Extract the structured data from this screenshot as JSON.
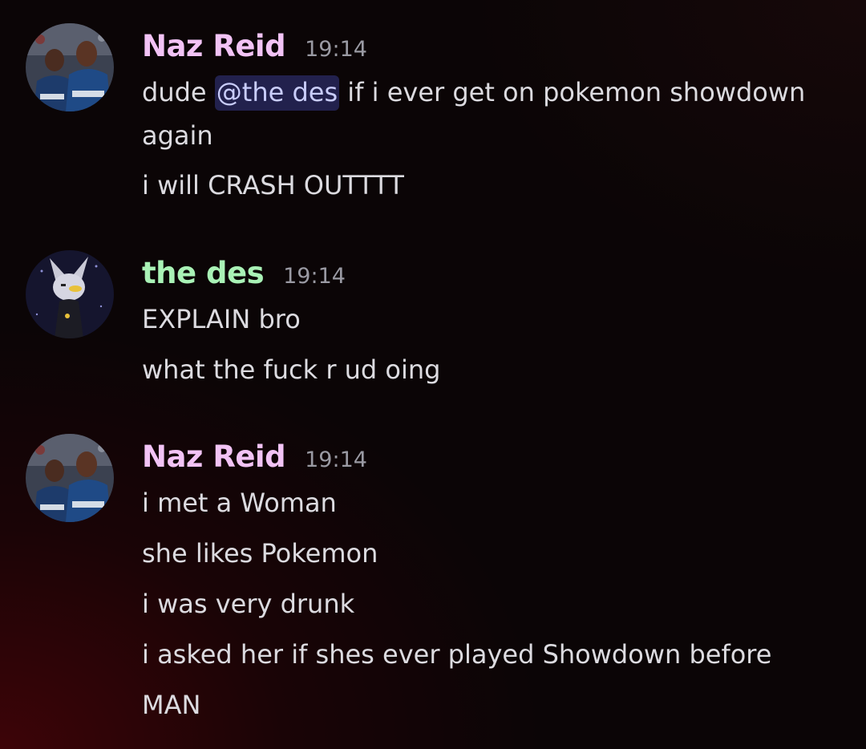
{
  "colors": {
    "naz_name": "#f2c3f5",
    "des_name": "#a9f2b6",
    "mention_bg": "#3a3f7a",
    "message_text": "#dcdbe0",
    "timestamp": "#9a9aa3"
  },
  "messages": [
    {
      "author": "Naz Reid",
      "time": "19:14",
      "avatar_icon": "basketball-players-avatar",
      "line1_before": "dude ",
      "mention": "@the des",
      "line1_after": " if i ever get on pokemon showdown",
      "line1_cont": "again",
      "line2": "i will CRASH OUTTTT"
    },
    {
      "author": "the des",
      "time": "19:14",
      "avatar_icon": "cartoon-character-avatar",
      "line1": "EXPLAIN bro",
      "line2": "what the fuck r ud oing"
    },
    {
      "author": "Naz Reid",
      "time": "19:14",
      "avatar_icon": "basketball-players-avatar",
      "line1": "i met a Woman",
      "line2": "she likes Pokemon",
      "line3": "i was very drunk",
      "line4": "i asked her if shes ever played Showdown before",
      "line5": "MAN"
    }
  ]
}
